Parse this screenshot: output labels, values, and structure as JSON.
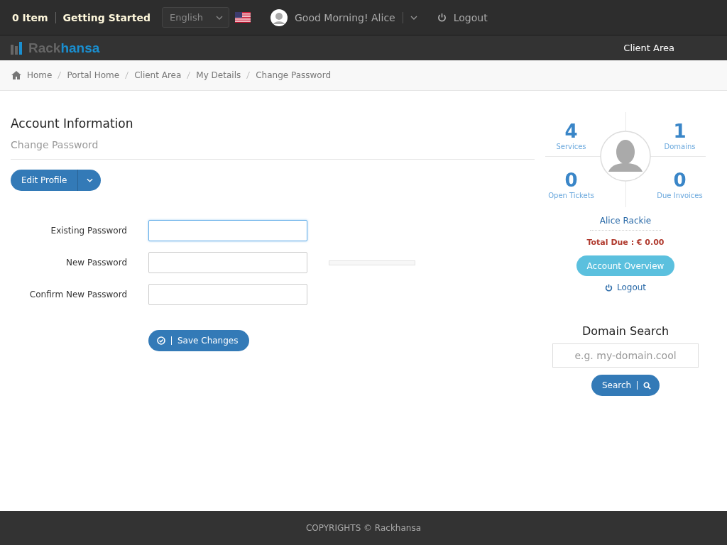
{
  "top_bar": {
    "cart": "0 Item",
    "getting_started": "Getting Started",
    "language": "English",
    "greeting": "Good Morning! Alice",
    "logout": "Logout"
  },
  "nav_bar": {
    "logo": {
      "part_1": "Rack",
      "part_2": "hansa"
    },
    "client_area": "Client Area"
  },
  "breadcrumb": [
    "Home",
    "Portal Home",
    "Client Area",
    "My Details",
    "Change Password"
  ],
  "main": {
    "title": "Account Information",
    "subtitle": "Change Password",
    "edit_profile": "Edit Profile",
    "fields": [
      {
        "label": "Existing Password",
        "focused": true
      },
      {
        "label": "New Password",
        "focused": false
      },
      {
        "label": "Confirm New Password",
        "focused": false
      }
    ],
    "strength_meter": {
      "level": 0
    },
    "save": "Save Changes"
  },
  "sidebar": {
    "stats": [
      {
        "value": "4",
        "label": "Services"
      },
      {
        "value": "1",
        "label": "Domains"
      },
      {
        "value": "0",
        "label": "Open Tickets"
      },
      {
        "value": "0",
        "label": "Due Invoices"
      }
    ],
    "name": "Alice Rackie",
    "total_due": "Total Due : € 0.00",
    "account_overview": "Account Overview",
    "logout": "Logout",
    "domain_search": {
      "title": "Domain Search",
      "placeholder": "e.g. my-domain.cool",
      "button": "Search"
    }
  },
  "footer": "COPYRIGHTS © Rackhansa"
}
